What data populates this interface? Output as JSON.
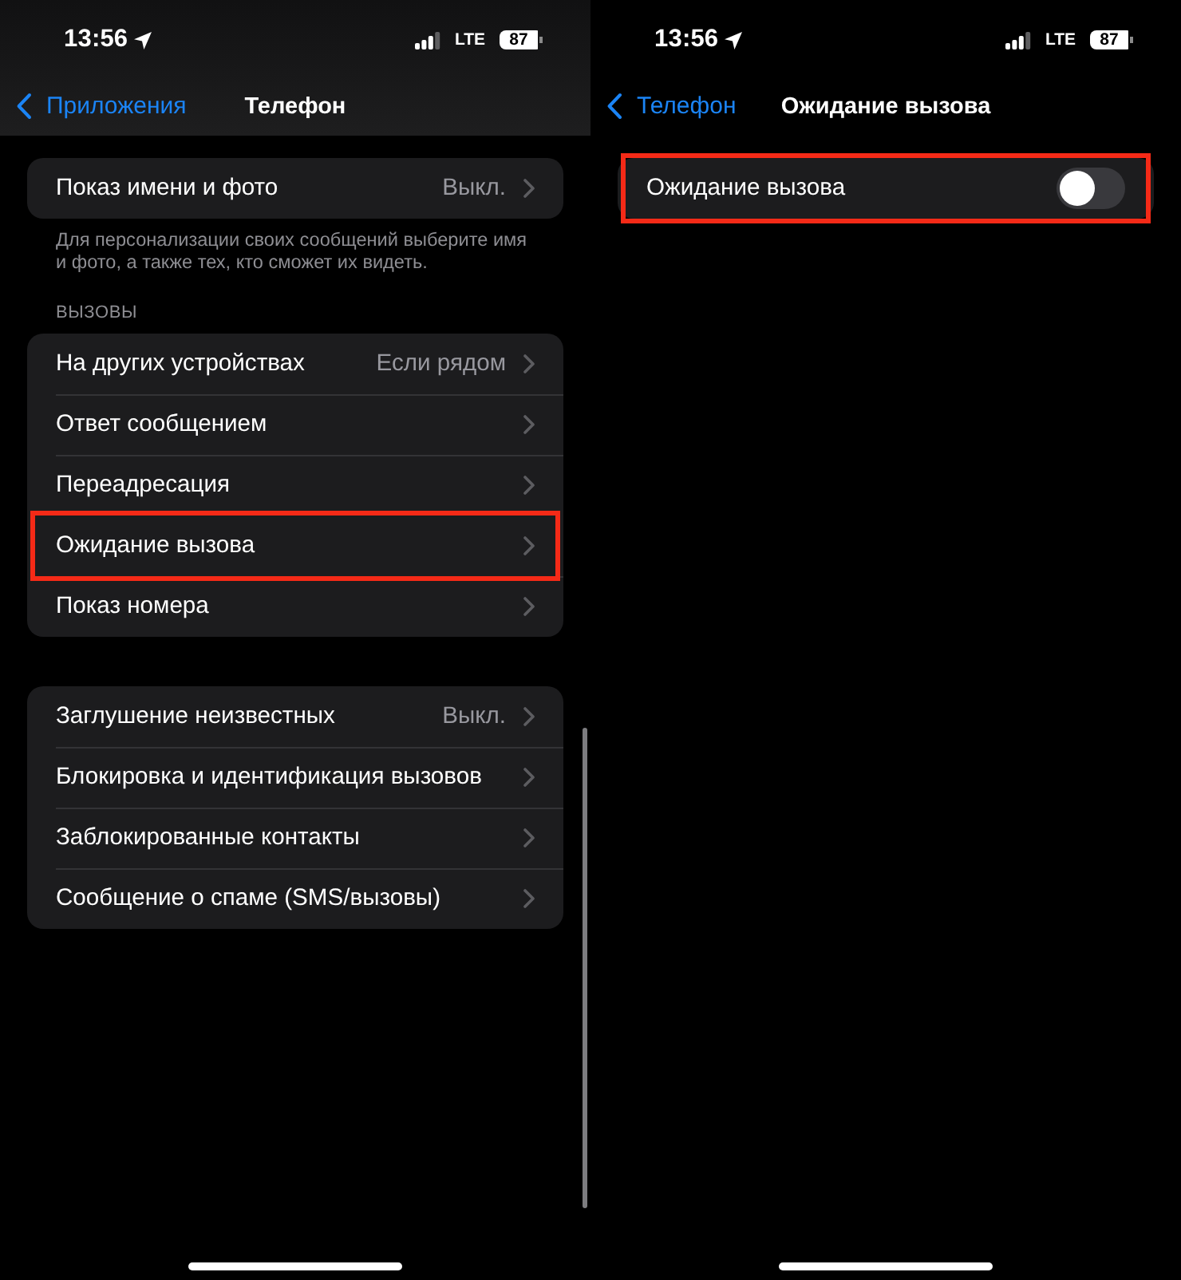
{
  "screens": [
    {
      "status_bar": {
        "time": "13:56",
        "network": "LTE",
        "battery": "87"
      },
      "scrolled": true,
      "nav": {
        "back": "Приложения",
        "title": "Телефон"
      },
      "groups": [
        {
          "rows": [
            {
              "kind": "link",
              "label": "Показ имени и фото",
              "value": "Выкл.",
              "highlighted": false
            }
          ],
          "footer": "Для персонализации своих сообщений выберите имя и фото, а также тех, кто сможет их видеть."
        },
        {
          "header": "ВЫЗОВЫ",
          "rows": [
            {
              "kind": "link",
              "label": "На других устройствах",
              "value": "Если рядом",
              "highlighted": false
            },
            {
              "kind": "link",
              "label": "Ответ сообщением",
              "highlighted": false
            },
            {
              "kind": "link",
              "label": "Переадресация",
              "highlighted": false
            },
            {
              "kind": "link",
              "label": "Ожидание вызова",
              "highlighted": true
            },
            {
              "kind": "link",
              "label": "Показ номера",
              "highlighted": false
            }
          ]
        },
        {
          "rows": [
            {
              "kind": "link",
              "label": "Заглушение неизвестных",
              "value": "Выкл.",
              "highlighted": false
            },
            {
              "kind": "link",
              "label": "Блокировка и идентификация вызовов",
              "highlighted": false
            },
            {
              "kind": "link",
              "label": "Заблокированные контакты",
              "highlighted": false
            },
            {
              "kind": "link",
              "label": "Сообщение о спаме (SMS/вызовы)",
              "highlighted": false
            }
          ]
        }
      ]
    },
    {
      "status_bar": {
        "time": "13:56",
        "network": "LTE",
        "battery": "87"
      },
      "scrolled": false,
      "nav": {
        "back": "Телефон",
        "title": "Ожидание вызова"
      },
      "groups": [
        {
          "rows": [
            {
              "kind": "toggle",
              "label": "Ожидание вызова",
              "on": false,
              "highlighted": true
            }
          ]
        }
      ]
    }
  ]
}
